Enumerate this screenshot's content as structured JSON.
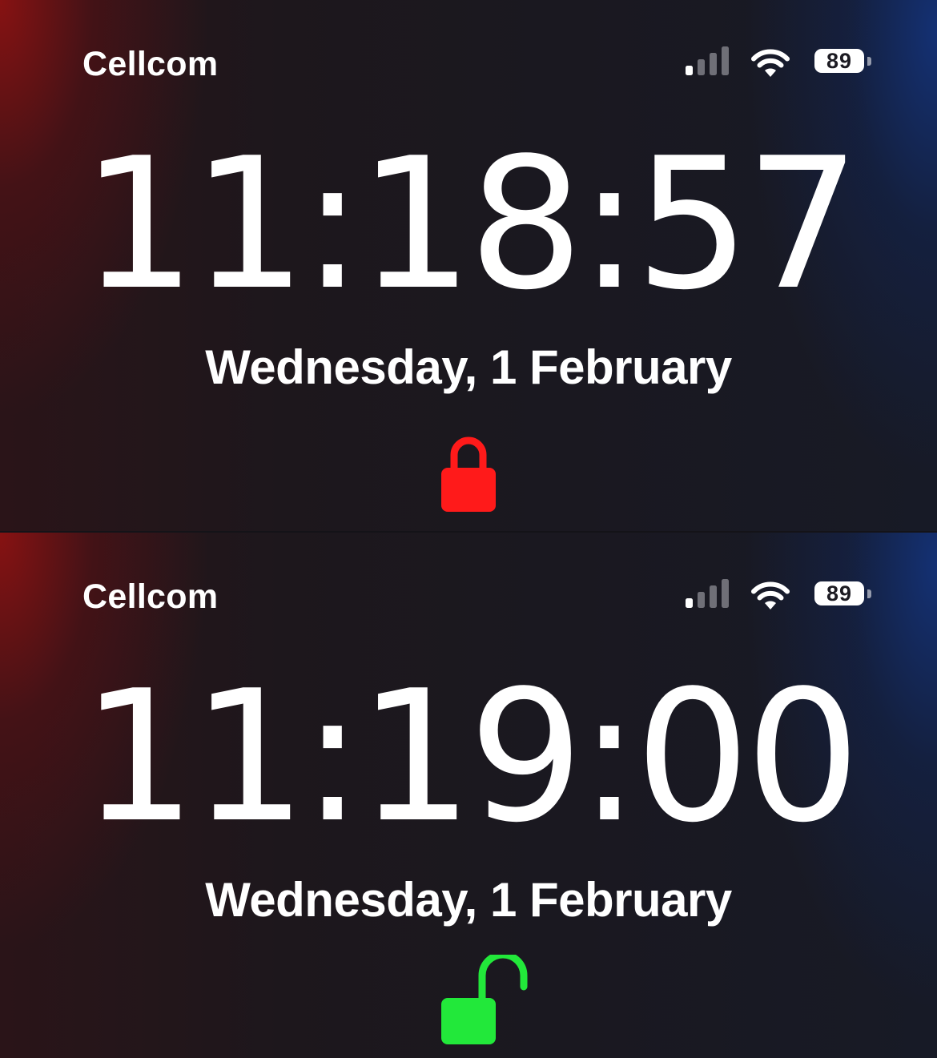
{
  "screens": [
    {
      "carrier": "Cellcom",
      "battery_level": "89",
      "time": "11:18:57",
      "date": "Wednesday, 1 February",
      "lock_state": "locked",
      "lock_icon": "lock-closed-icon",
      "lock_color": "#ff1a1a"
    },
    {
      "carrier": "Cellcom",
      "battery_level": "89",
      "time": "11:19:00",
      "date": "Wednesday, 1 February",
      "lock_state": "unlocked",
      "lock_icon": "lock-open-icon",
      "lock_color": "#22e83a"
    }
  ],
  "status_bar": {
    "signal_bars_active": 1,
    "signal_bars_total": 4,
    "icons": [
      "cellular-signal-icon",
      "wifi-icon",
      "battery-icon"
    ]
  }
}
